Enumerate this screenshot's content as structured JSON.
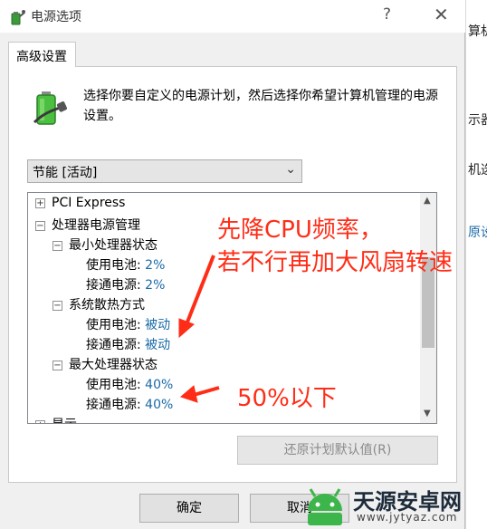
{
  "background_window": {
    "fragments": [
      "算机",
      "示器",
      "机选",
      "原设"
    ]
  },
  "window": {
    "title": "电源选项",
    "help_glyph": "?",
    "close_glyph": "✕"
  },
  "tab": {
    "label": "高级设置"
  },
  "description": "选择你要自定义的电源计划，然后选择你希望计算机管理的电源设置。",
  "plan_select": {
    "value": "节能 [活动]"
  },
  "tree": {
    "items": [
      {
        "expander": "+",
        "label": "PCI Express",
        "value": ""
      },
      {
        "expander": "−",
        "label": "处理器电源管理",
        "value": ""
      },
      {
        "expander": "−",
        "label": "最小处理器状态",
        "value": ""
      },
      {
        "expander": "",
        "label": "使用电池:",
        "value": "2%"
      },
      {
        "expander": "",
        "label": "接通电源:",
        "value": "2%"
      },
      {
        "expander": "−",
        "label": "系统散热方式",
        "value": ""
      },
      {
        "expander": "",
        "label": "使用电池:",
        "value": "被动"
      },
      {
        "expander": "",
        "label": "接通电源:",
        "value": "被动"
      },
      {
        "expander": "−",
        "label": "最大处理器状态",
        "value": ""
      },
      {
        "expander": "",
        "label": "使用电池:",
        "value": "40%"
      },
      {
        "expander": "",
        "label": "接通电源:",
        "value": "40%"
      },
      {
        "expander": "+",
        "label": "显示",
        "value": ""
      }
    ],
    "scroll_position": 0.45
  },
  "buttons": {
    "restore": "还原计划默认值(R)",
    "ok": "确定",
    "cancel": "取消"
  },
  "annotations": {
    "line1": "先降CPU频率，",
    "line2": "若不行再加大风扇转速",
    "line3": "50%以下",
    "color": "#ff2d17"
  },
  "watermark": {
    "name": "天源安卓网",
    "url": "www.jytyaz.com"
  }
}
